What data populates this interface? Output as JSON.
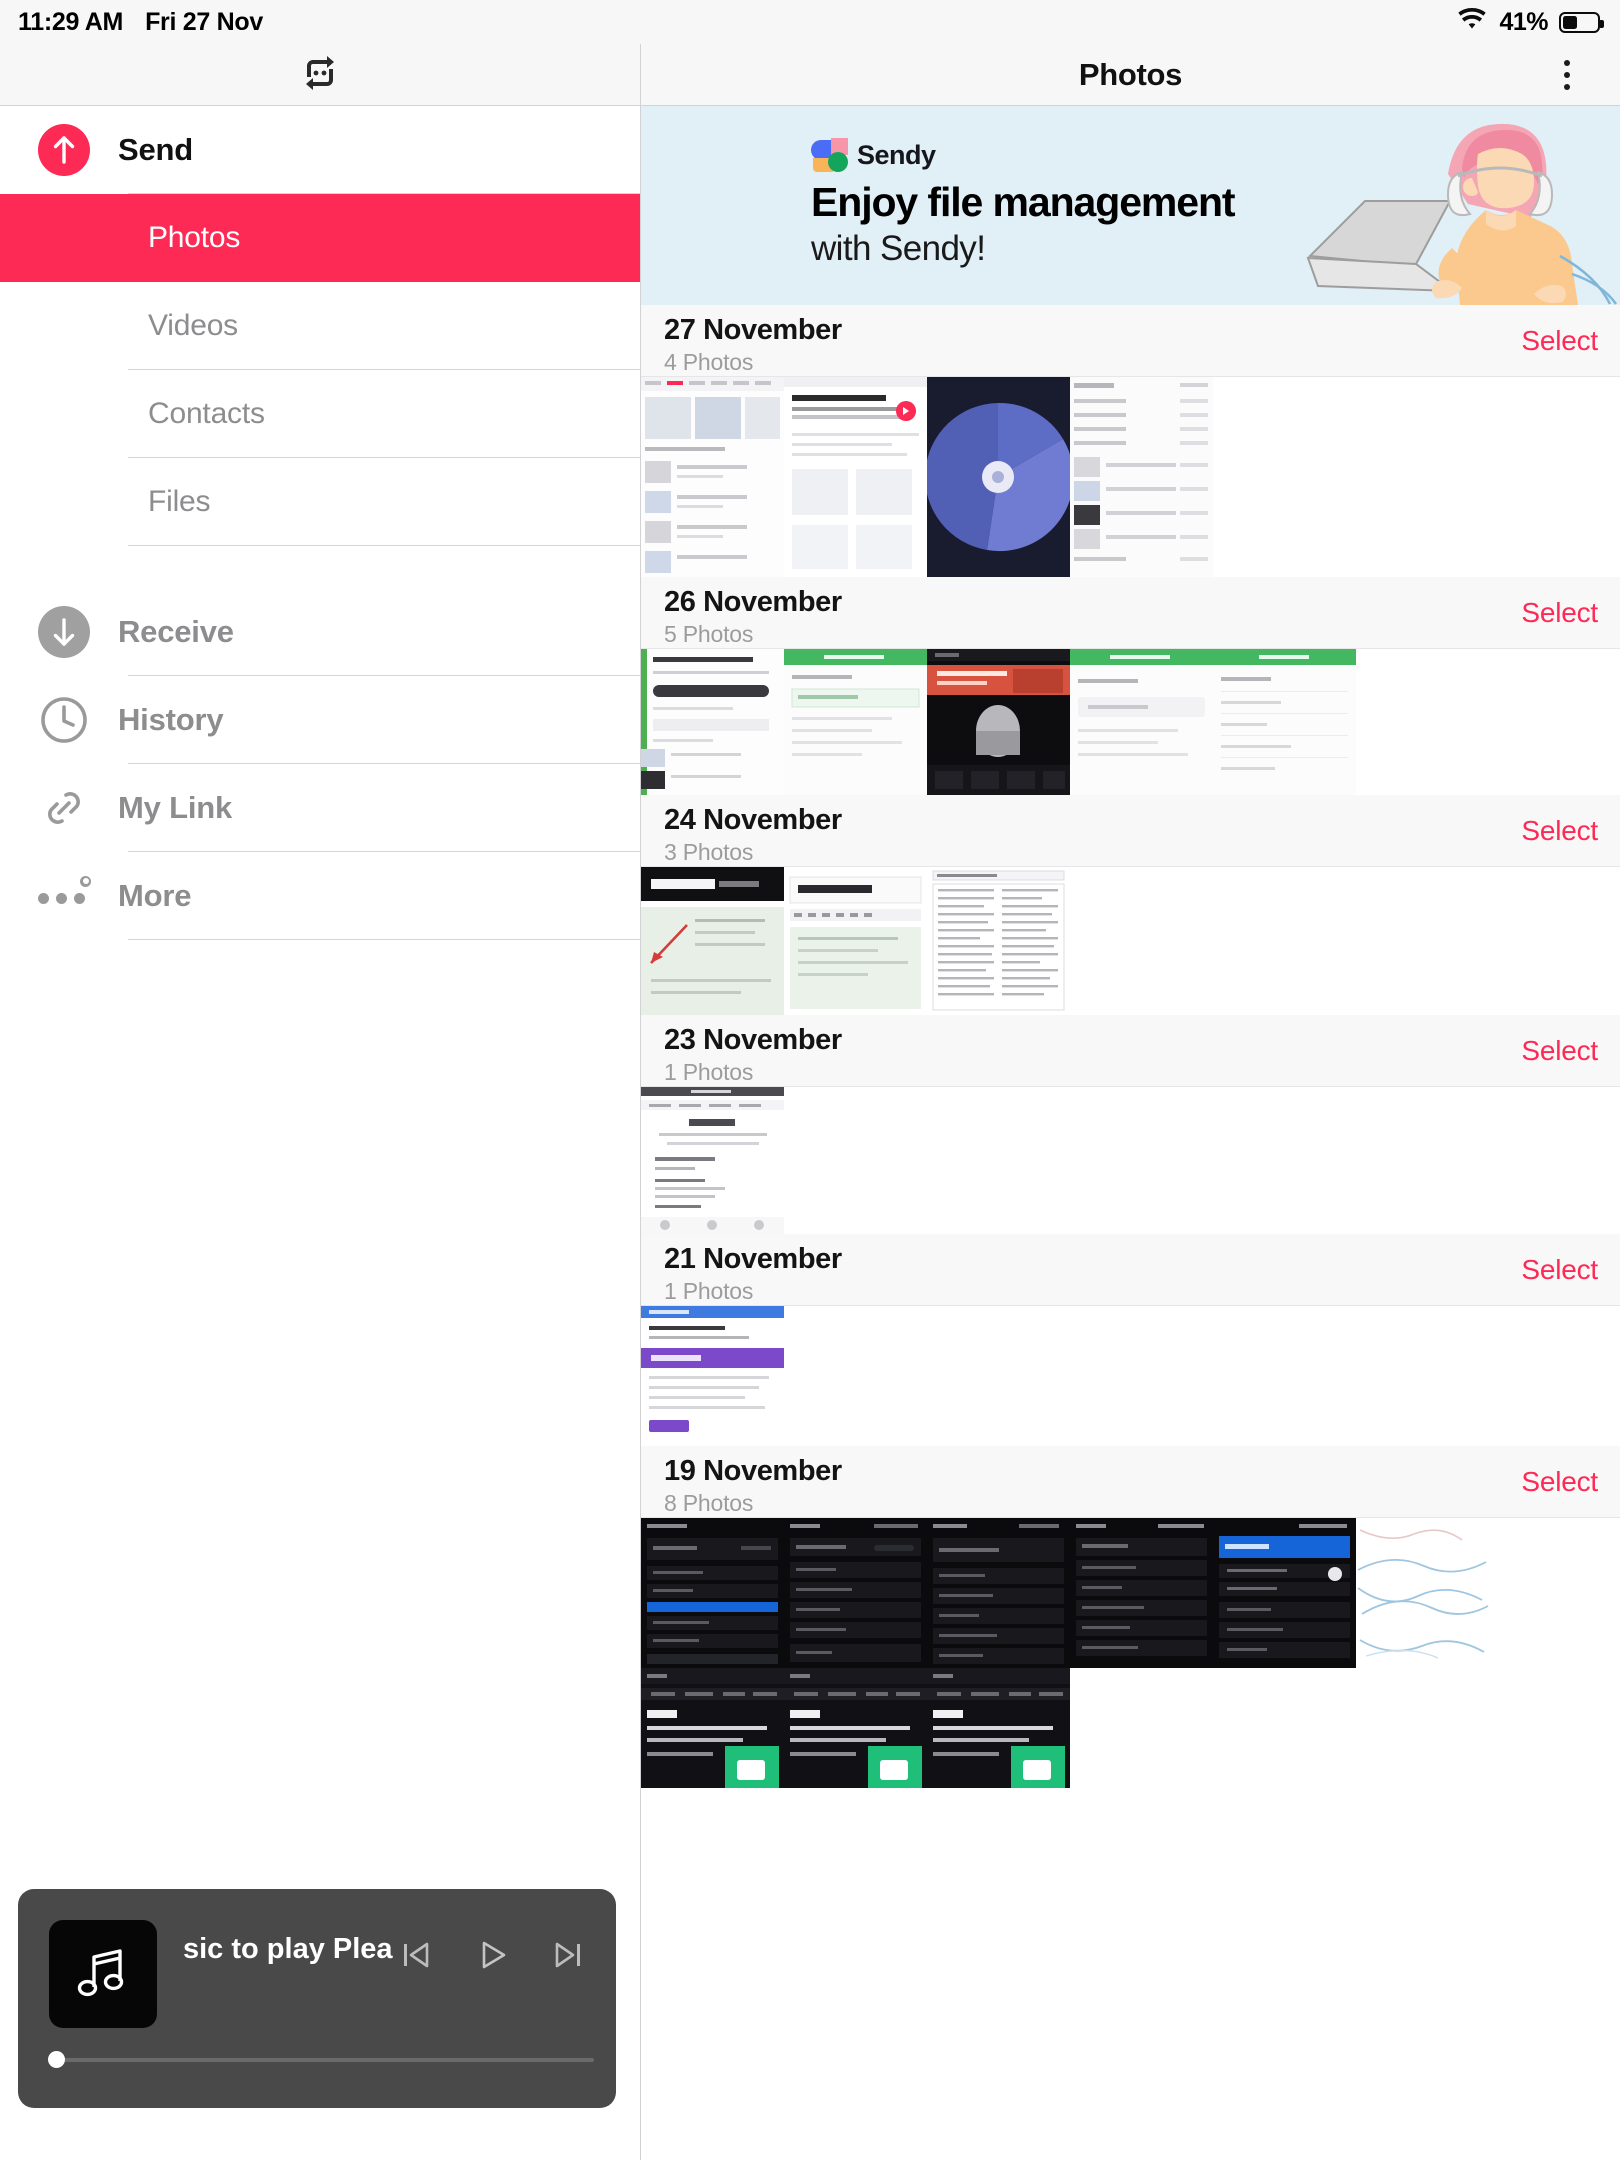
{
  "status_bar": {
    "time": "11:29 AM",
    "date": "Fri 27 Nov",
    "battery_percent": "41%",
    "wifi_icon": "wifi-icon",
    "battery_icon": "battery-icon"
  },
  "header": {
    "title": "Photos",
    "left_icon": "repeat-rotate-icon",
    "overflow_icon": "kebab-menu-icon"
  },
  "sidebar": {
    "send": {
      "label": "Send",
      "icon": "arrow-up-circle-icon"
    },
    "send_children": [
      {
        "label": "Photos",
        "selected": true
      },
      {
        "label": "Videos",
        "selected": false
      },
      {
        "label": "Contacts",
        "selected": false
      },
      {
        "label": "Files",
        "selected": false
      }
    ],
    "items": [
      {
        "label": "Receive",
        "icon": "arrow-down-circle-icon",
        "badge": false
      },
      {
        "label": "History",
        "icon": "clock-icon",
        "badge": false
      },
      {
        "label": "My Link",
        "icon": "link-chain-icon",
        "badge": false
      },
      {
        "label": "More",
        "icon": "ellipsis-icon",
        "badge": true
      }
    ]
  },
  "banner": {
    "brand": "Sendy",
    "headline": "Enjoy file management",
    "subline": "with Sendy!",
    "logo_icon": "sendy-logo-icon",
    "illustration": "woman-with-laptop-illustration",
    "background_color": "#e1eff6"
  },
  "accent_color": "#fd2a55",
  "select_label": "Select",
  "groups": [
    {
      "date": "27 November",
      "count": "4 Photos",
      "thumbs": [
        {
          "kind": "app-list-screenshot"
        },
        {
          "kind": "web-article-screenshot"
        },
        {
          "kind": "dark-radial-screenshot"
        },
        {
          "kind": "settings-list-screenshot"
        },
        {
          "kind": "blank"
        },
        {
          "kind": "blank"
        },
        {
          "kind": "blank"
        }
      ]
    },
    {
      "date": "26 November",
      "count": "5 Photos",
      "thumbs": [
        {
          "kind": "share-photos-screenshot"
        },
        {
          "kind": "green-banner-screenshot"
        },
        {
          "kind": "apple-dark-screenshot"
        },
        {
          "kind": "green-banner-screenshot"
        },
        {
          "kind": "green-loading-screenshot"
        },
        {
          "kind": "blank"
        },
        {
          "kind": "blank"
        }
      ]
    },
    {
      "date": "24 November",
      "count": "3 Photos",
      "thumbs": [
        {
          "kind": "tech-latest-screenshot"
        },
        {
          "kind": "sample-post-screenshot"
        },
        {
          "kind": "document-form-screenshot"
        },
        {
          "kind": "blank"
        },
        {
          "kind": "blank"
        },
        {
          "kind": "blank"
        },
        {
          "kind": "blank"
        }
      ]
    },
    {
      "date": "23 November",
      "count": "1 Photos",
      "thumbs": [
        {
          "kind": "results-page-screenshot"
        },
        {
          "kind": "blank"
        },
        {
          "kind": "blank"
        },
        {
          "kind": "blank"
        },
        {
          "kind": "blank"
        },
        {
          "kind": "blank"
        },
        {
          "kind": "blank"
        }
      ]
    },
    {
      "date": "21 November",
      "count": "1 Photos",
      "thumbs": [
        {
          "kind": "google-forms-screenshot"
        },
        {
          "kind": "blank"
        },
        {
          "kind": "blank"
        },
        {
          "kind": "blank"
        },
        {
          "kind": "blank"
        },
        {
          "kind": "blank"
        },
        {
          "kind": "blank"
        }
      ]
    },
    {
      "date": "19 November",
      "count": "8 Photos",
      "thumbs": [
        {
          "kind": "dark-settings-screenshot"
        },
        {
          "kind": "dark-settings-screenshot"
        },
        {
          "kind": "dark-settings-screenshot"
        },
        {
          "kind": "dark-settings-screenshot"
        },
        {
          "kind": "dark-apple-id-screenshot"
        },
        {
          "kind": "line-drawing-screenshot"
        },
        {
          "kind": "blank"
        }
      ]
    }
  ],
  "overflow_row": {
    "thumbs": [
      {
        "kind": "dark-pick-screenshot"
      },
      {
        "kind": "dark-pick-screenshot"
      },
      {
        "kind": "dark-pick-screenshot"
      },
      {
        "kind": "blank"
      },
      {
        "kind": "blank"
      },
      {
        "kind": "blank"
      },
      {
        "kind": "blank"
      }
    ]
  },
  "player": {
    "title_text": "sic to play   Plea",
    "artwork_icon": "music-note-icon",
    "prev_icon": "skip-previous-icon",
    "play_icon": "play-icon",
    "next_icon": "skip-next-icon",
    "progress_percent": 0
  }
}
